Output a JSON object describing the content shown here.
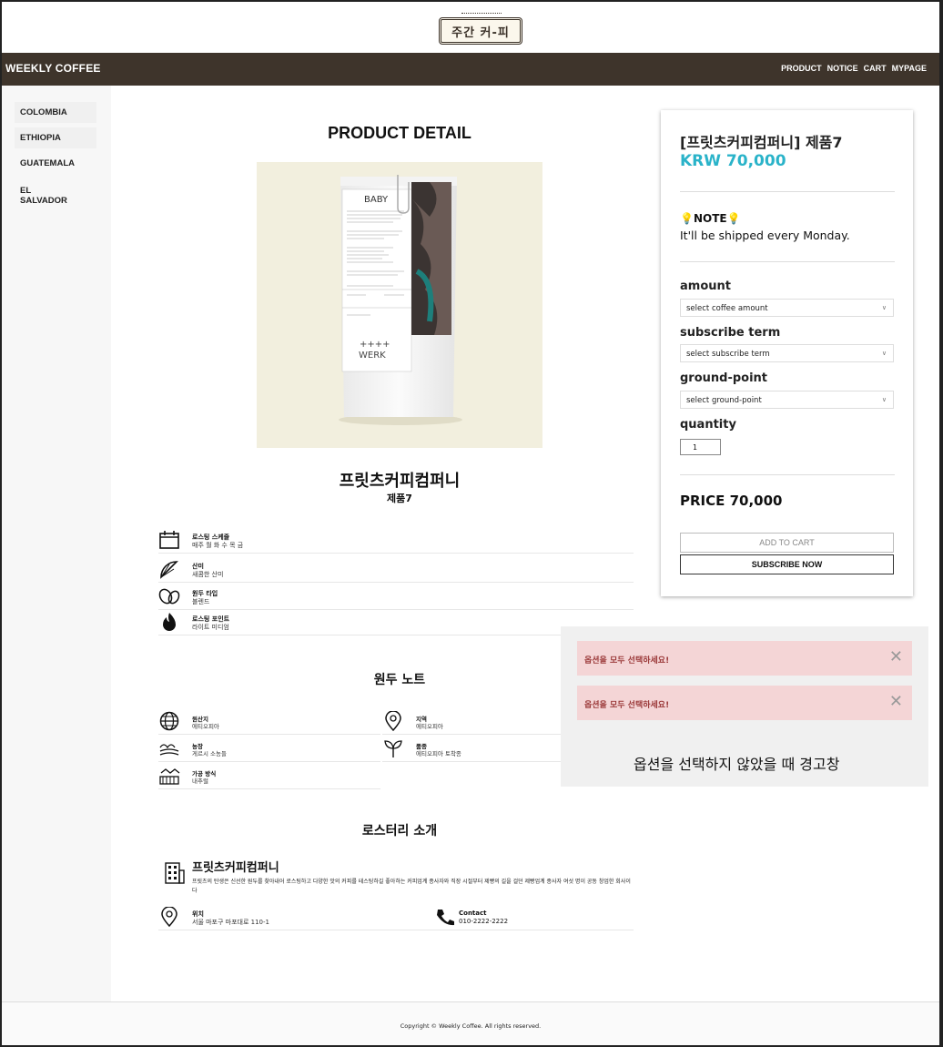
{
  "logo_text": "주간 커-피",
  "nav": {
    "brand": "WEEKLY COFFEE",
    "links": [
      "PRODUCT",
      "NOTICE",
      "CART",
      "MYPAGE"
    ]
  },
  "sidebar": {
    "items": [
      {
        "label": "COLOMBIA"
      },
      {
        "label": "ETHIOPIA"
      },
      {
        "label": "GUATEMALA"
      },
      {
        "label": "EL SALVADOR"
      }
    ]
  },
  "main": {
    "page_title": "PRODUCT DETAIL",
    "product_name": "프릿츠커피컴퍼니",
    "product_sub": "제품7",
    "image": {
      "bag_brand": "BABY",
      "bag_logo": "++++\nWERK"
    },
    "info_rows": [
      {
        "icon": "calendar-icon",
        "title": "로스팅 스케줄",
        "value": "매주 월 화 수 목 금"
      },
      {
        "icon": "citrus-slice-icon",
        "title": "산미",
        "value": "새콤한 산미"
      },
      {
        "icon": "beans-icon",
        "title": "원두 타입",
        "value": "블렌드"
      },
      {
        "icon": "roast-fire-icon",
        "title": "로스팅 포인트",
        "value": "라이트 미디엄"
      }
    ],
    "bean_note_title": "원두 노트",
    "bean_notes": [
      {
        "icon": "globe-icon",
        "title": "원산지",
        "value": "에티오피아"
      },
      {
        "icon": "location-pin-icon",
        "title": "지역",
        "value": "에티오피아"
      },
      {
        "icon": "farm-icon",
        "title": "농장",
        "value": "게르시 소농들"
      },
      {
        "icon": "sprout-icon",
        "title": "품종",
        "value": "에티오피아 토착종"
      },
      {
        "icon": "process-icon",
        "title": "가공 방식",
        "value": "내추럴"
      }
    ],
    "roaster_title": "로스터리 소개",
    "roaster": {
      "name": "프릿츠커피컴퍼니",
      "description": "프릿츠의 탄생은 신선한 원두를 찾아내어 로스팅하고 다양한 맛의 커피를 테스팅하길 좋아하는 커피업계 종사자와 직장 시절부터 제빵의 길을 걸던 제빵업계 종사자 여섯 명이 공동 창업한 회사이다",
      "location_label": "위치",
      "location_value": "서울 마포구 마포대로 110-1",
      "contact_label": "Contact",
      "contact_value": "010-2222-2222"
    }
  },
  "panel": {
    "title": "[프릿츠커피컴퍼니] 제품7",
    "price": "KRW 70,000",
    "note_title": "NOTE",
    "note_text": "It'll be shipped every Monday.",
    "fields": [
      {
        "label": "amount",
        "placeholder": "select coffee amount"
      },
      {
        "label": "subscribe term",
        "placeholder": "select subscribe term"
      },
      {
        "label": "ground-point",
        "placeholder": "select ground-point"
      }
    ],
    "quantity_label": "quantity",
    "quantity_value": "1",
    "total": "PRICE 70,000",
    "add_to_cart": "ADD TO CART",
    "subscribe_now": "SUBSCRIBE NOW"
  },
  "alerts": {
    "messages": [
      "옵션을 모두 선택하세요!",
      "옵션을 모두 선택하세요!"
    ],
    "caption": "옵션을 선택하지 않았을 때 경고창"
  },
  "footer": {
    "copyright": "Copyright © Weekly Coffee. All rights reserved."
  },
  "colors": {
    "nav_bg": "#3e342b",
    "price_accent": "#2ab3c9",
    "alert_bg": "#f4d5d6",
    "alert_text": "#9b3a3a"
  }
}
